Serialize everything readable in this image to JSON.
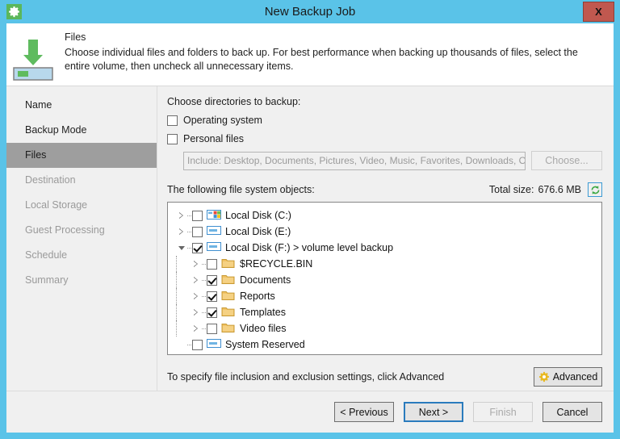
{
  "window": {
    "title": "New Backup Job",
    "app_icon": "gear-icon",
    "close_label": "X",
    "titlebar_color": "#5ac3e8",
    "close_color": "#c0584f"
  },
  "header": {
    "icon": "backup-down-arrow-icon",
    "title": "Files",
    "description": "Choose individual files and folders to back up. For best performance when backing up thousands of files, select the entire volume, then uncheck all unnecessary items."
  },
  "sidebar": {
    "items": [
      {
        "label": "Name",
        "state": "done"
      },
      {
        "label": "Backup Mode",
        "state": "done"
      },
      {
        "label": "Files",
        "state": "active"
      },
      {
        "label": "Destination",
        "state": "dim"
      },
      {
        "label": "Local Storage",
        "state": "dim"
      },
      {
        "label": "Guest Processing",
        "state": "dim"
      },
      {
        "label": "Schedule",
        "state": "dim"
      },
      {
        "label": "Summary",
        "state": "dim"
      }
    ]
  },
  "content": {
    "directories_label": "Choose directories to backup:",
    "operating_system": {
      "label": "Operating system",
      "checked": false
    },
    "personal_files": {
      "label": "Personal files",
      "checked": false
    },
    "include_field": {
      "value": "Include: Desktop, Documents, Pictures, Video, Music, Favorites, Downloads, Other",
      "placeholder": "Include: Desktop, Documents, Pictures, Video, Music, Favorites, Downloads, Other",
      "enabled": false
    },
    "choose_button": {
      "label": "Choose...",
      "enabled": false
    },
    "objects_label": "The following file system objects:",
    "total_size_label": "Total size:",
    "total_size_value": "676.6 MB",
    "refresh_icon": "refresh-icon",
    "tree": [
      {
        "label": "Local Disk (C:)",
        "level": 0,
        "checked": false,
        "expander": "collapsed",
        "icon": "windows-drive-icon"
      },
      {
        "label": "Local Disk (E:)",
        "level": 0,
        "checked": false,
        "expander": "collapsed",
        "icon": "drive-icon"
      },
      {
        "label": "Local Disk (F:) > volume level backup",
        "level": 0,
        "checked": true,
        "expander": "expanded",
        "icon": "drive-icon"
      },
      {
        "label": "$RECYCLE.BIN",
        "level": 1,
        "checked": false,
        "expander": "collapsed",
        "icon": "folder-icon"
      },
      {
        "label": "Documents",
        "level": 1,
        "checked": true,
        "expander": "collapsed",
        "icon": "folder-icon"
      },
      {
        "label": "Reports",
        "level": 1,
        "checked": true,
        "expander": "collapsed",
        "icon": "folder-icon"
      },
      {
        "label": "Templates",
        "level": 1,
        "checked": true,
        "expander": "collapsed",
        "icon": "folder-icon"
      },
      {
        "label": "Video files",
        "level": 1,
        "checked": false,
        "expander": "collapsed",
        "icon": "folder-icon"
      },
      {
        "label": "System Reserved",
        "level": 0,
        "checked": false,
        "expander": "none",
        "icon": "drive-icon"
      }
    ],
    "hint_text": "To specify file inclusion and exclusion settings, click Advanced",
    "advanced_button": {
      "label": "Advanced",
      "icon": "gear-icon"
    }
  },
  "buttons": {
    "previous": {
      "label": "< Previous",
      "enabled": true
    },
    "next": {
      "label": "Next >",
      "enabled": true,
      "focused": true
    },
    "finish": {
      "label": "Finish",
      "enabled": false
    },
    "cancel": {
      "label": "Cancel",
      "enabled": true
    }
  }
}
